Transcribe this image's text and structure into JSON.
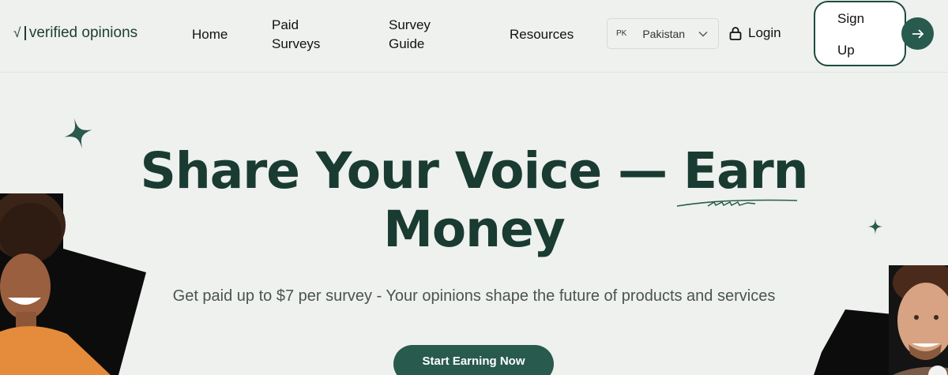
{
  "header": {
    "logo_text": "verified opinions",
    "logo_mark": "√",
    "nav": [
      {
        "label": "Home"
      },
      {
        "label": "Paid Surveys"
      },
      {
        "label": "Survey Guide"
      },
      {
        "label": "Resources"
      }
    ],
    "country": {
      "code": "PK",
      "name": "Pakistan"
    },
    "login_label": "Login",
    "signup_line1": "Sign",
    "signup_line2": "Up"
  },
  "hero": {
    "title_line1": "Share Your Voice — Earn",
    "title_line2": "Money",
    "subtitle": "Get paid up to $7 per survey - Your opinions shape the future of products and services",
    "cta_label": "Start Earning Now"
  },
  "colors": {
    "background": "#eef1ee",
    "primary": "#285a4d",
    "heading": "#193b32"
  }
}
